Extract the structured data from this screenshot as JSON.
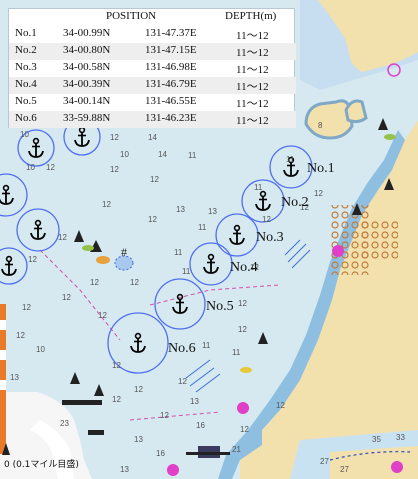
{
  "table": {
    "headers": {
      "position": "POSITION",
      "depth": "DEPTH(m)"
    },
    "rows": [
      {
        "no": "No.1",
        "lat": "34-00.99N",
        "lon": "131-47.37E",
        "depth": "11～12"
      },
      {
        "no": "No.2",
        "lat": "34-00.80N",
        "lon": "131-47.15E",
        "depth": "11～12"
      },
      {
        "no": "No.3",
        "lat": "34-00.58N",
        "lon": "131-46.98E",
        "depth": "11～12"
      },
      {
        "no": "No.4",
        "lat": "34-00.39N",
        "lon": "131-46.79E",
        "depth": "11～12"
      },
      {
        "no": "No.5",
        "lat": "34-00.14N",
        "lon": "131-46.55E",
        "depth": "11～12"
      },
      {
        "no": "No.6",
        "lat": "33-59.88N",
        "lon": "131-46.23E",
        "depth": "11～12"
      }
    ]
  },
  "anchorages": [
    {
      "label": "No.1"
    },
    {
      "label": "No.2"
    },
    {
      "label": "No.3"
    },
    {
      "label": "No.4"
    },
    {
      "label": "No.5"
    },
    {
      "label": "No.6"
    }
  ],
  "scale_label": "0 (0.1マイル目盛)",
  "depth_soundings": [
    "10",
    "12",
    "14",
    "10",
    "12",
    "10",
    "12",
    "14",
    "11",
    "12",
    "12",
    "13",
    "12",
    "11",
    "11",
    "13",
    "12",
    "12",
    "11",
    "12",
    "12",
    "12",
    "12",
    "11",
    "12",
    "12",
    "11",
    "12",
    "12",
    "12",
    "12",
    "12",
    "11",
    "12",
    "11",
    "12",
    "12",
    "13",
    "12",
    "13",
    "12",
    "13",
    "12",
    "16",
    "12",
    "10",
    "12",
    "16",
    "13",
    "23",
    "21",
    "27",
    "27",
    "35",
    "33",
    "8"
  ],
  "colors": {
    "water": "#d6e9f1",
    "land": "#f3e1ad",
    "shallow": "#8fbfe0",
    "anchor_circle": "#4f6ff0",
    "buoy_magenta": "#e040c8",
    "table_bg": "#ffffff"
  },
  "icons": [
    "anchor-icon",
    "buoy-icon",
    "beacon-icon",
    "wreck-icon",
    "lighthouse-icon"
  ]
}
